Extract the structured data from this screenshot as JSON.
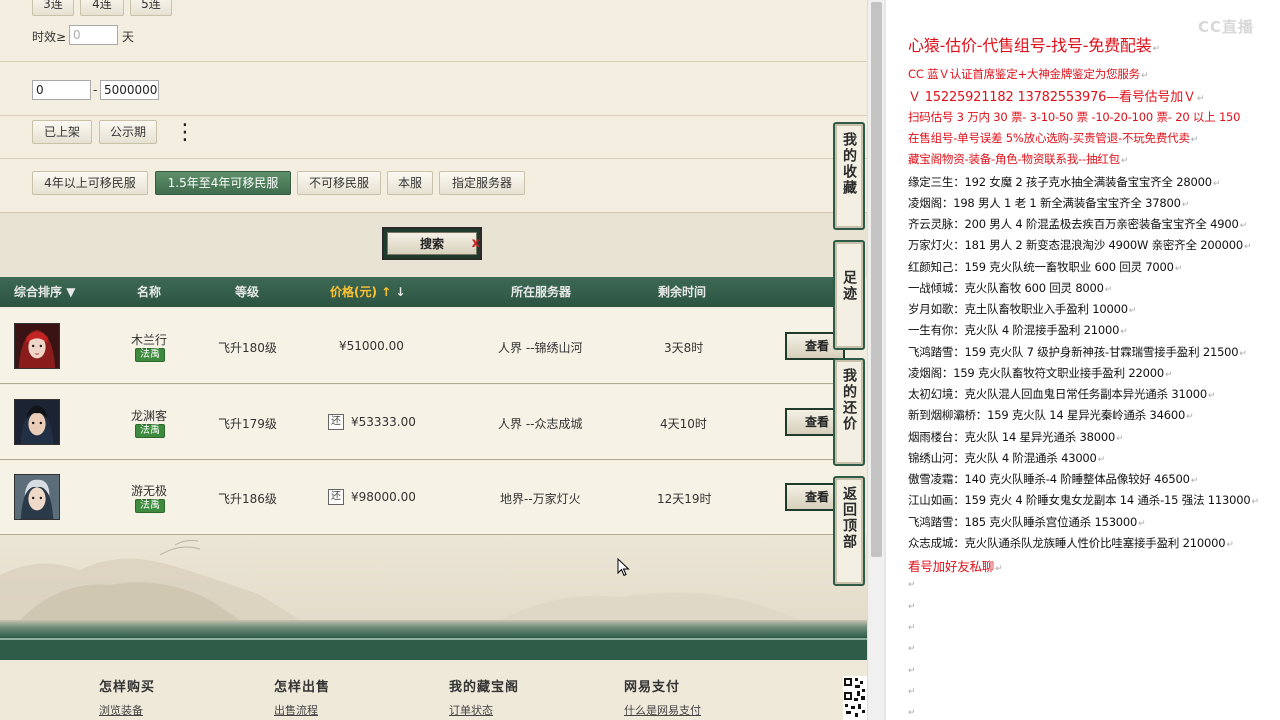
{
  "filters": {
    "combo_buttons": [
      "3连",
      "4连",
      "5连"
    ],
    "validity_label": "时效≥",
    "validity_placeholder": "0",
    "validity_unit": "天",
    "price_min": "0",
    "price_max": "5000000",
    "price_sep": "-",
    "status_buttons": [
      "已上架",
      "公示期"
    ],
    "more_menu": "⋮",
    "migrate_buttons": [
      "4年以上可移民服",
      "1.5年至4年可移民服",
      "不可移民服",
      "本服",
      "指定服务器"
    ]
  },
  "search": {
    "label": "搜索",
    "close": "x"
  },
  "table": {
    "headers": {
      "sort": "综合排序",
      "name": "名称",
      "level": "等级",
      "price": "价格(元)",
      "server": "所在服务器",
      "time": "剩余时间"
    },
    "rows": [
      {
        "name": "木兰行",
        "class": "法禹",
        "level": "飞升180级",
        "price": "¥51000.00",
        "haggle": "",
        "server": "人界 --锦绣山河",
        "time": "3天8时",
        "action": "查看"
      },
      {
        "name": "龙渊客",
        "class": "法禹",
        "level": "飞升179级",
        "price": "¥53333.00",
        "haggle": "还",
        "server": "人界 --众志成城",
        "time": "4天10时",
        "action": "查看"
      },
      {
        "name": "游无极",
        "class": "法禹",
        "level": "飞升186级",
        "price": "¥98000.00",
        "haggle": "还",
        "server": "地界--万家灯火",
        "time": "12天19时",
        "action": "查看"
      }
    ]
  },
  "side_tabs": [
    "我的收藏",
    "足迹",
    "我的还价",
    "返回顶部"
  ],
  "footer": {
    "columns": [
      {
        "title": "怎样购买",
        "link": "浏览装备"
      },
      {
        "title": "怎样出售",
        "link": "出售流程"
      },
      {
        "title": "我的藏宝阁",
        "link": "订单状态"
      },
      {
        "title": "网易支付",
        "link": "什么是网易支付"
      }
    ]
  },
  "doc": {
    "watermark": "CC直播",
    "title": "心猿-估价-代售组号-找号-免费配装",
    "red_lines": [
      "CC 蓝Ｖ认证首席鉴定+大神金牌鉴定为您服务",
      "Ｖ 15225921182      13782553976—看号估号加Ｖ",
      "扫码估号 3 万内 30 票- 3-10-50 票  -10-20-100 票- 20 以上 150",
      "在售组号-单号误差 5%放心选购-买贵管退-不玩免费代卖",
      "藏宝阁物资-装备-角色-物资联系我--抽红包"
    ],
    "listings": [
      "缘定三生：192 女魔 2 孩子克水抽全满装备宝宝齐全 28000",
      "凌烟阁：198 男人 1 老 1 新全满装备宝宝齐全 37800",
      "齐云灵脉：200 男人 4 阶混孟极去疾百万亲密装备宝宝齐全 4900",
      "万家灯火：181 男人 2 新变态混浪淘沙 4900W 亲密齐全 200000",
      "红颜知己：159 克火队统一畜牧职业 600 回灵 7000",
      "一战倾城：克火队畜牧 600 回灵 8000",
      "岁月如歌：克土队畜牧职业入手盈利 10000",
      "一生有你：克火队 4 阶混接手盈利 21000",
      "飞鸿踏雪：159 克火队 7 级护身新神孩-甘霖瑞雪接手盈利 21500",
      "凌烟阁：159 克火队畜牧符文职业接手盈利 22000",
      "太初幻境：克火队混人回血鬼日常任务副本异光通杀 31000",
      "新到烟柳灞桥：159 克火队 14 星异光秦岭通杀 34600",
      "烟雨楼台：克火队 14 星异光通杀 38000",
      "锦绣山河：克火队 4 阶混通杀 43000",
      "傲雪凌霜：140 克火队睡杀-4 阶睡整体品像较好 46500",
      "江山如画：159 克火 4 阶睡女鬼女龙副本 14 通杀-15 强法 113000",
      "飞鸿踏雪：185 克火队睡杀宫位通杀 153000",
      "众志成城：克火队通杀队龙族睡人性价比哇塞接手盈利 210000"
    ],
    "closing": "看号加好友私聊",
    "para_mark": "↵"
  }
}
